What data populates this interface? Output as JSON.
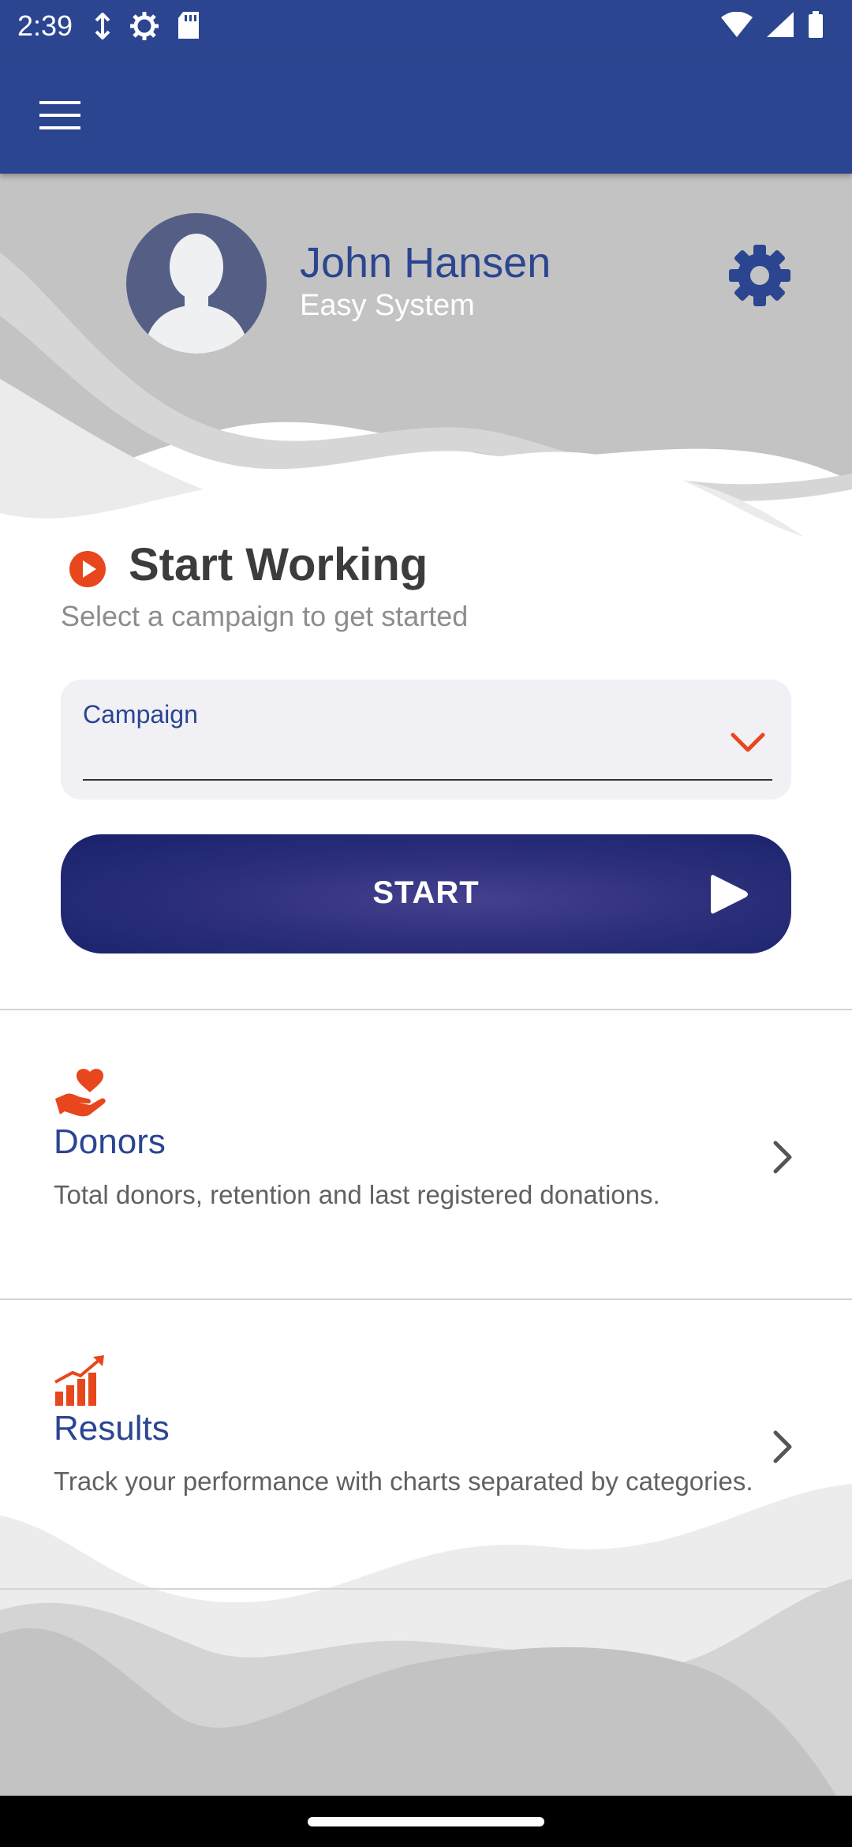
{
  "status_bar": {
    "time": "2:39"
  },
  "app_bar": {
    "menu_icon": "hamburger-menu-icon"
  },
  "profile": {
    "name": "John Hansen",
    "subtitle": "Easy System",
    "settings_icon": "gear-icon"
  },
  "start_working": {
    "title": "Start Working",
    "subtitle": "Select a campaign to get started"
  },
  "campaign": {
    "label": "Campaign",
    "value": ""
  },
  "start_button": {
    "label": "START"
  },
  "cards": [
    {
      "title": "Donors",
      "description": "Total donors, retention and last registered donations.",
      "icon": "heart-hand-icon"
    },
    {
      "title": "Results",
      "description": "Track your performance with charts separated by categories.",
      "icon": "growth-chart-icon"
    }
  ],
  "colors": {
    "primary": "#2b4590",
    "accent": "#e8461c",
    "button_dark": "#17226a",
    "header_gray": "#c4c4c4"
  }
}
